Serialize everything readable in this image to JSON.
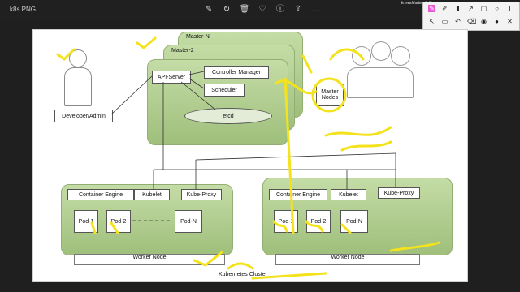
{
  "window": {
    "filename": "k8s.PNG"
  },
  "toolbar": {
    "icons": [
      "edit-image-icon",
      "rotate-icon",
      "delete-icon",
      "heart-icon",
      "info-icon",
      "share-icon",
      "more-icon"
    ]
  },
  "recorder": {
    "logo": "ScreenMarker & Recorder"
  },
  "diagram": {
    "masters": [
      "Master-N",
      "Master-2"
    ],
    "api_server": "API-Server",
    "controller_manager": "Controller Manager",
    "scheduler": "Scheduler",
    "etcd": "etcd",
    "developer": "Developer/Admin",
    "master_nodes": "Master Nodes",
    "worker1": {
      "engine": "Container Engine",
      "kubelet": "Kubelet",
      "proxy": "Kube-Proxy",
      "pods": [
        "Pod-1",
        "Pod-2",
        "Pod-N"
      ],
      "label": "Worker Node"
    },
    "worker2": {
      "engine": "Container Engine",
      "kubelet": "Kubelet",
      "proxy": "Kube-Proxy",
      "pods": [
        "Pod-1",
        "Pod-2",
        "Pod-N"
      ],
      "label": "Worker Node"
    },
    "cluster_label": "Kubernetes Cluster"
  },
  "annotations": {
    "colors": {
      "ink": "#f4e21c"
    }
  }
}
